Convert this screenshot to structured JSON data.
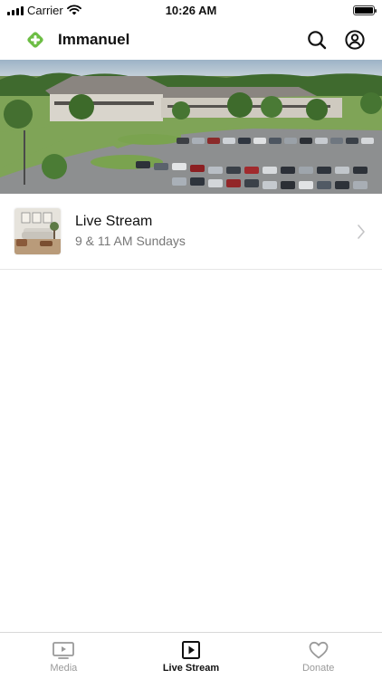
{
  "status_bar": {
    "carrier": "Carrier",
    "time": "10:26 AM"
  },
  "header": {
    "title": "Immanuel",
    "logo_icon": "church-logo-icon",
    "logo_color": "#6DBE45"
  },
  "hero": {
    "alt": "Church building and parking lot"
  },
  "list": {
    "items": [
      {
        "title": "Live Stream",
        "subtitle": "9 & 11 AM Sundays",
        "thumb_icon": "living-room-thumbnail"
      }
    ]
  },
  "tabs": [
    {
      "label": "Media",
      "icon": "media-icon",
      "active": false
    },
    {
      "label": "Live Stream",
      "icon": "live-stream-icon",
      "active": true
    },
    {
      "label": "Donate",
      "icon": "heart-icon",
      "active": false
    }
  ],
  "colors": {
    "accent": "#6DBE45",
    "inactive": "#9a9a9a"
  }
}
